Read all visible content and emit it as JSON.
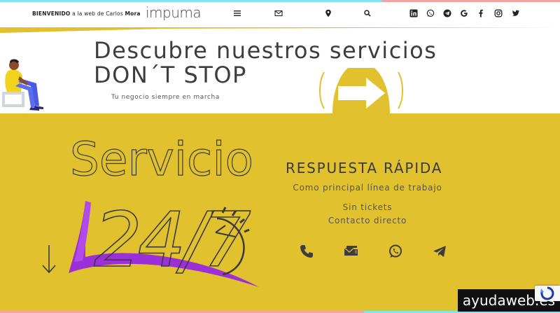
{
  "header": {
    "welcome_prefix": "BIENVENIDO",
    "welcome_mid": "a la web de Carlos",
    "welcome_name": "Mora",
    "logo": "impuma",
    "icons": [
      "menu-icon",
      "mail-icon",
      "location-icon",
      "search-icon",
      "linkedin-icon",
      "whatsapp-icon",
      "telegram-icon",
      "google-icon",
      "facebook-icon",
      "instagram-icon",
      "twitter-icon"
    ]
  },
  "hero": {
    "title_line1": "Descubre  nuestros  servicios",
    "title_line2": "DON´T  STOP",
    "subtitle": "Tu negocio siempre en marcha"
  },
  "section": {
    "graphic_text_top": "Servicio",
    "graphic_text_bottom": "24/7",
    "title": "RESPUESTA RÁPIDA",
    "line1": "Como principal línea de trabajo",
    "line2": "Sin tickets",
    "line3": "Contacto directo",
    "contact_icons": [
      "phone-icon",
      "email-contact-icon",
      "whatsapp-contact-icon",
      "telegram-contact-icon"
    ]
  },
  "watermark": "ayudaweb.es",
  "colors": {
    "accent_yellow": "#e2c12f",
    "purple": "#9b30d9",
    "cyan": "#7ee7ee",
    "pink": "#f4a3a3"
  }
}
